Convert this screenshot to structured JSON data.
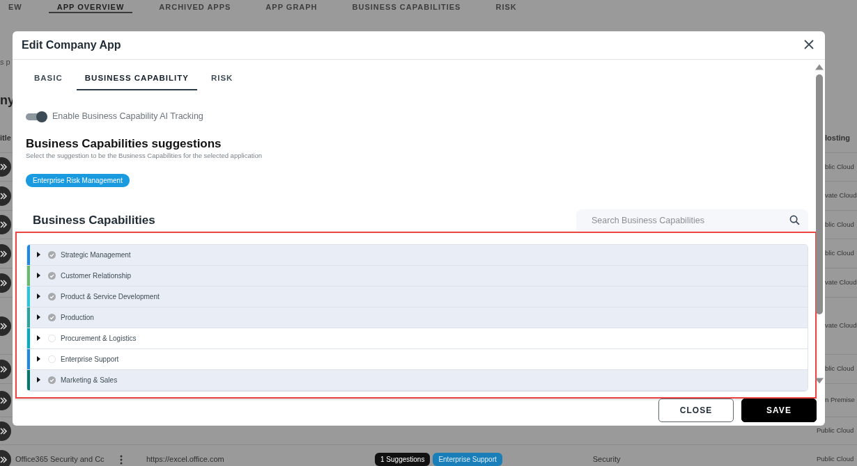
{
  "background": {
    "nav_tabs": [
      {
        "label": "EW",
        "selected": false
      },
      {
        "label": "APP OVERVIEW",
        "selected": true
      },
      {
        "label": "ARCHIVED APPS",
        "selected": false
      },
      {
        "label": "APP GRAPH",
        "selected": false
      },
      {
        "label": "BUSINESS CAPABILITIES",
        "selected": false
      },
      {
        "label": "RISK",
        "selected": false
      }
    ],
    "intro_fragment": "s p",
    "heading_fragment": "ny",
    "table": {
      "columns": [
        "itle",
        "losting"
      ],
      "rows": [
        {
          "hosting": "blic Cloud"
        },
        {
          "hosting": "vate Cloud"
        },
        {
          "hosting": "blic Cloud"
        },
        {
          "hosting": "blic Cloud"
        },
        {
          "hosting": "vate Cloud"
        },
        {
          "hosting": "vate Cloud"
        },
        {
          "hosting": "blic Cloud"
        },
        {
          "hosting": "n Premise"
        },
        {
          "hosting": "Public Cloud"
        },
        {
          "title": "Office365 Security and Cc",
          "url": "https://excel.office.com",
          "suggestions": "1 Suggestions",
          "capability": "Enterprise Support",
          "category": "Security",
          "hosting": "Public Cloud"
        }
      ]
    }
  },
  "dialog": {
    "title": "Edit Company App",
    "tabs": [
      {
        "label": "BASIC",
        "selected": false
      },
      {
        "label": "BUSINESS CAPABILITY",
        "selected": true
      },
      {
        "label": "RISK",
        "selected": false
      }
    ],
    "ai_tracking": {
      "label": "Enable Business Capability AI Tracking",
      "on": true
    },
    "suggestions": {
      "heading": "Business Capabilities suggestions",
      "subtitle": "Select the suggestion to be the Business Capabilities for the selected application",
      "tags": [
        "Enterprise Risk Management"
      ]
    },
    "capabilities": {
      "heading": "Business Capabilities",
      "search": {
        "placeholder": "Search Business Capabilities"
      },
      "items": [
        {
          "name": "Strategic Management",
          "checked": true,
          "expanded": false,
          "color": "#1e88e5"
        },
        {
          "name": "Customer Relationship",
          "checked": true,
          "expanded": false,
          "color": "#66bb6a"
        },
        {
          "name": "Product & Service Development",
          "checked": true,
          "expanded": false,
          "color": "#26c6da"
        },
        {
          "name": "Production",
          "checked": true,
          "expanded": false,
          "color": "#26a69a"
        },
        {
          "name": "Procurement & Logistics",
          "checked": false,
          "expanded": false,
          "color": "#00acc1"
        },
        {
          "name": "Enterprise Support",
          "checked": false,
          "expanded": false,
          "color": "#1e88e5"
        },
        {
          "name": "Marketing & Sales",
          "checked": true,
          "expanded": false,
          "color": "#00796b"
        }
      ]
    },
    "buttons": [
      {
        "label": "CLOSE",
        "kind": "outline"
      },
      {
        "label": "SAVE",
        "kind": "primary"
      }
    ]
  }
}
